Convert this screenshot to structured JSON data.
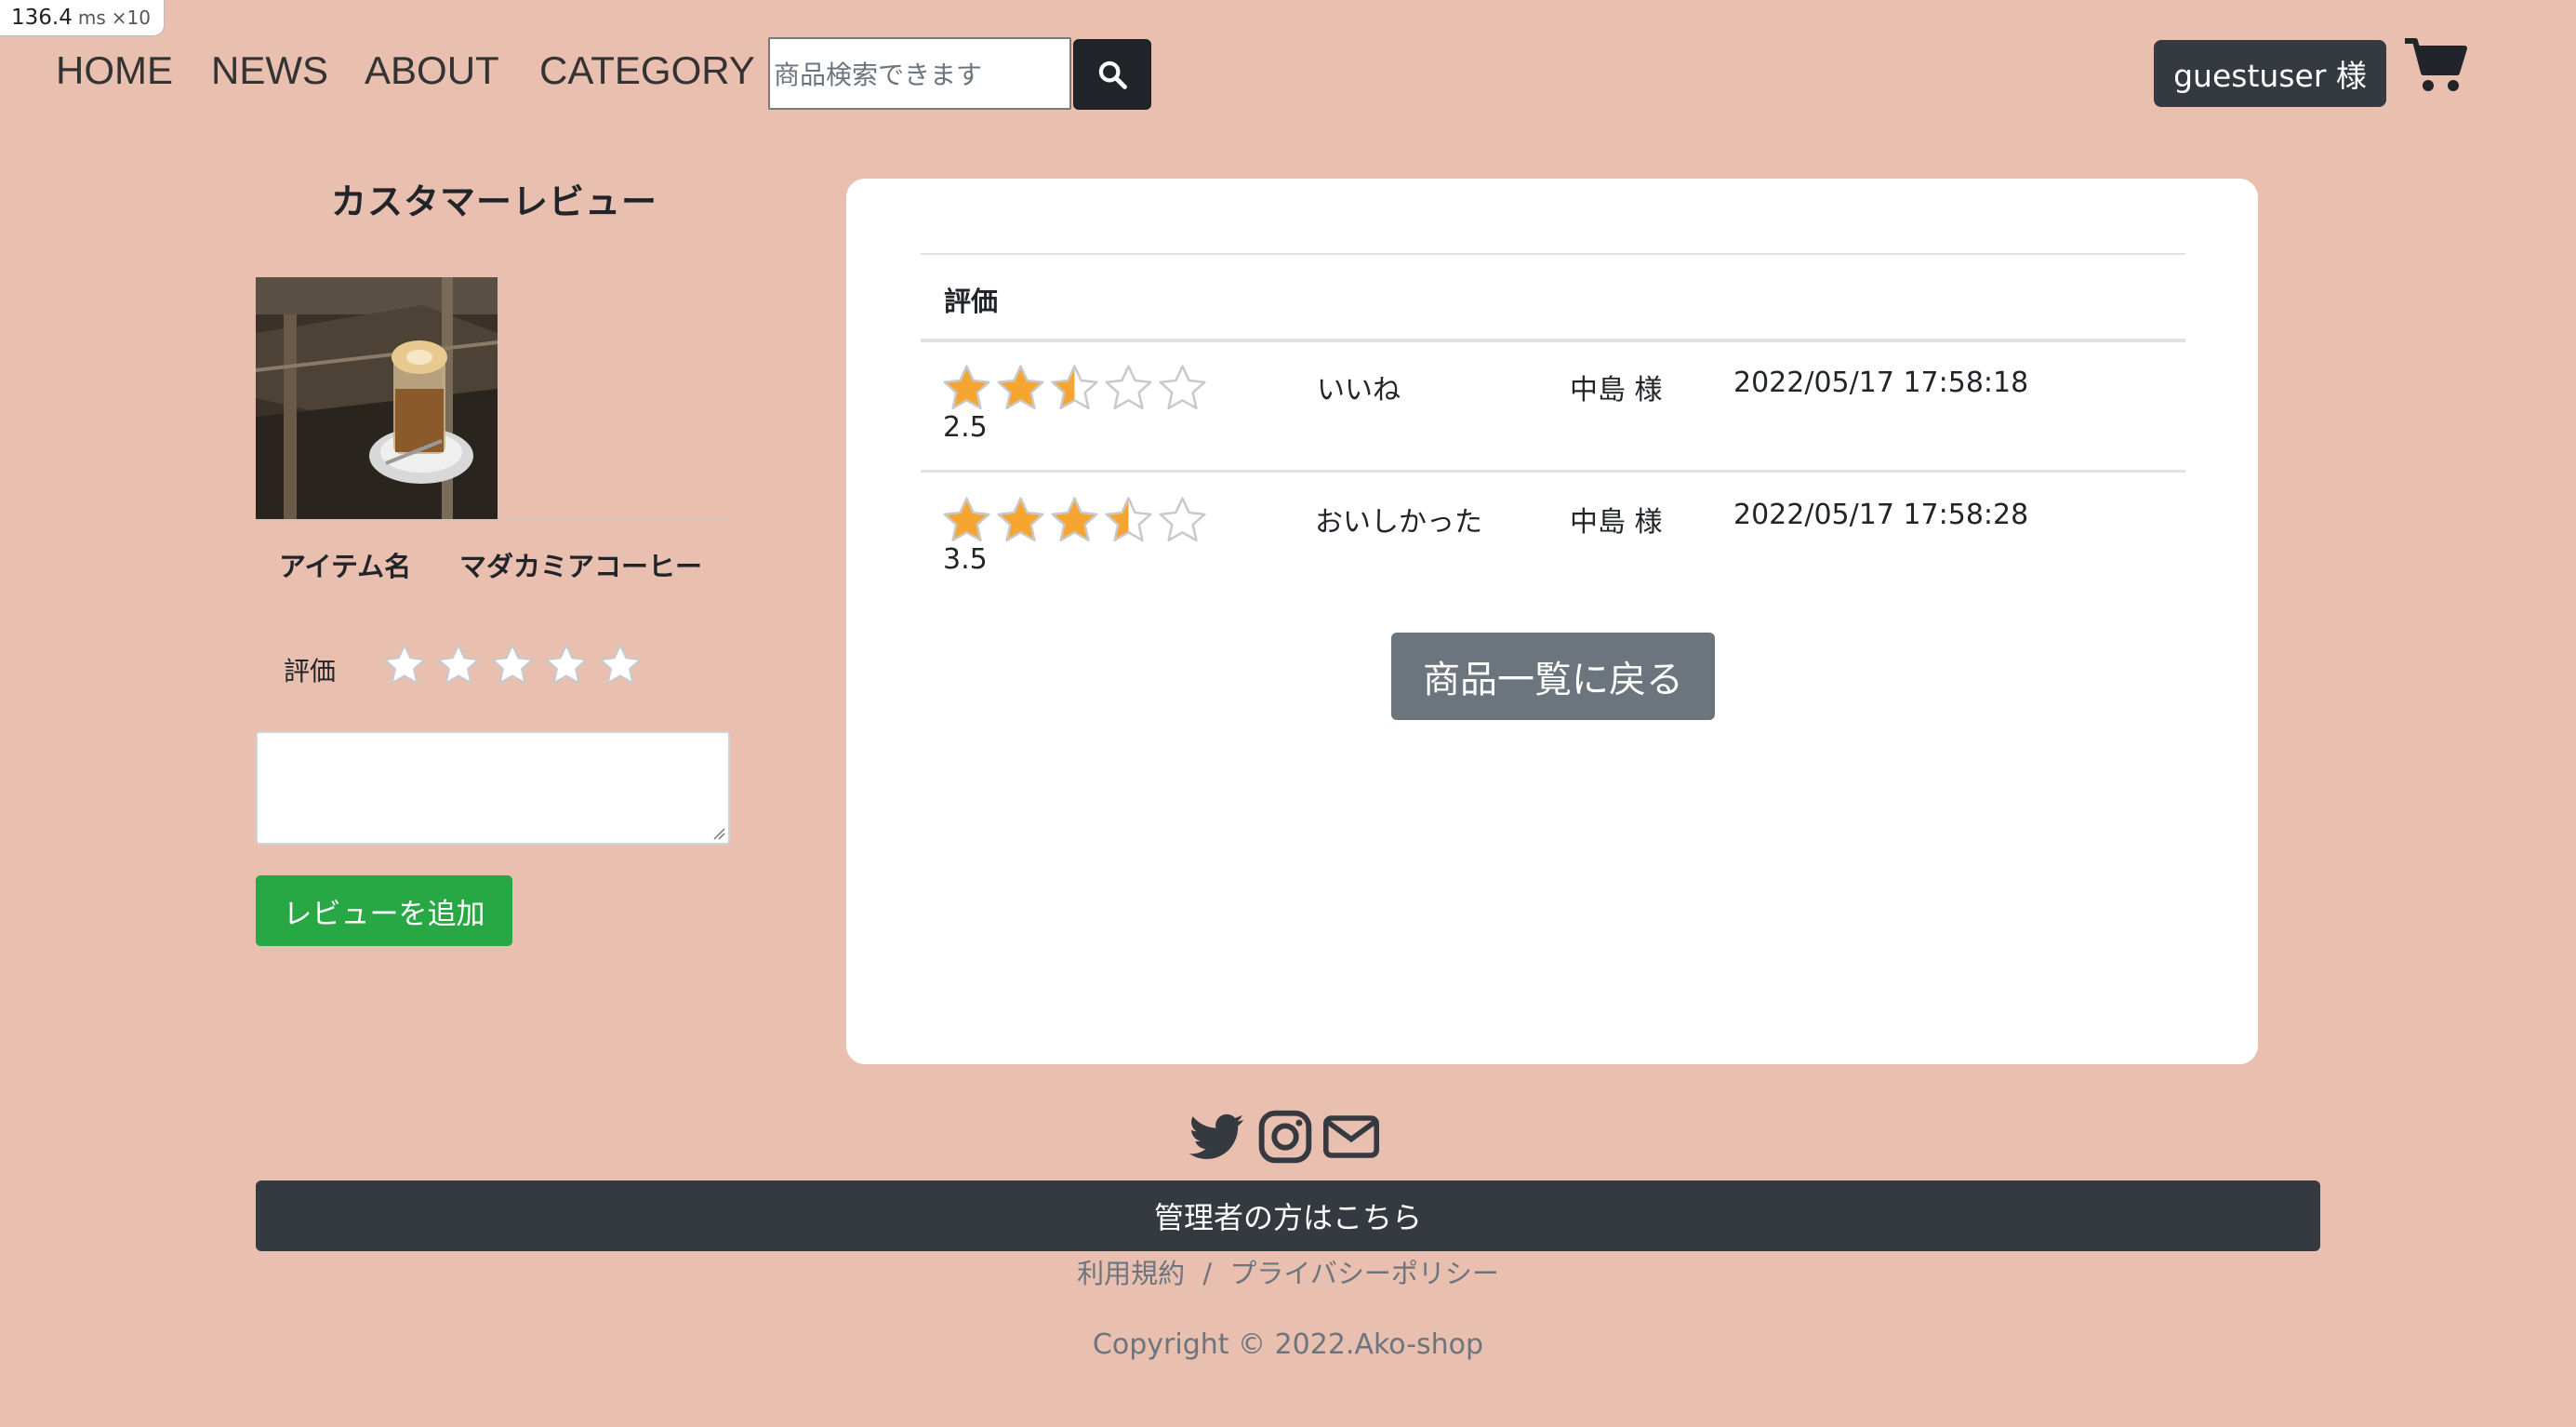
{
  "perf": {
    "value": "136.4",
    "unit": "ms",
    "multiplier": "×10"
  },
  "nav": {
    "links": [
      "HOME",
      "NEWS",
      "ABOUT",
      "CATEGORY"
    ],
    "search_placeholder": "商品検索できます",
    "user_label": "guestuser 様"
  },
  "review_form": {
    "title": "カスタマーレビュー",
    "item_name_label": "アイテム名",
    "item_name_value": "マダカミアコーヒー",
    "rating_label": "評価",
    "rating_value": 0,
    "submit_label": "レビューを追加"
  },
  "reviews": {
    "header_rating": "評価",
    "rows": [
      {
        "rating": 2.5,
        "rating_text": "2.5",
        "comment": "いいね",
        "user": "中島 様",
        "date": "2022/05/17 17:58:18"
      },
      {
        "rating": 3.5,
        "rating_text": "3.5",
        "comment": "おいしかった",
        "user": "中島 様",
        "date": "2022/05/17 17:58:28"
      }
    ],
    "back_label": "商品一覧に戻る"
  },
  "footer": {
    "social_icons": [
      "twitter-icon",
      "instagram-icon",
      "envelope-icon"
    ],
    "admin_label": "管理者の方はこちら",
    "terms_link": "利用規約",
    "separator": "/",
    "privacy_link": "プライバシーポリシー",
    "copyright": "Copyright © 2022.Ako-shop"
  },
  "colors": {
    "page_bg": "#e9bfb0",
    "star_on": "#f7a531",
    "add_button": "#28a745",
    "dark": "#343a40",
    "secondary": "#6c757d"
  }
}
